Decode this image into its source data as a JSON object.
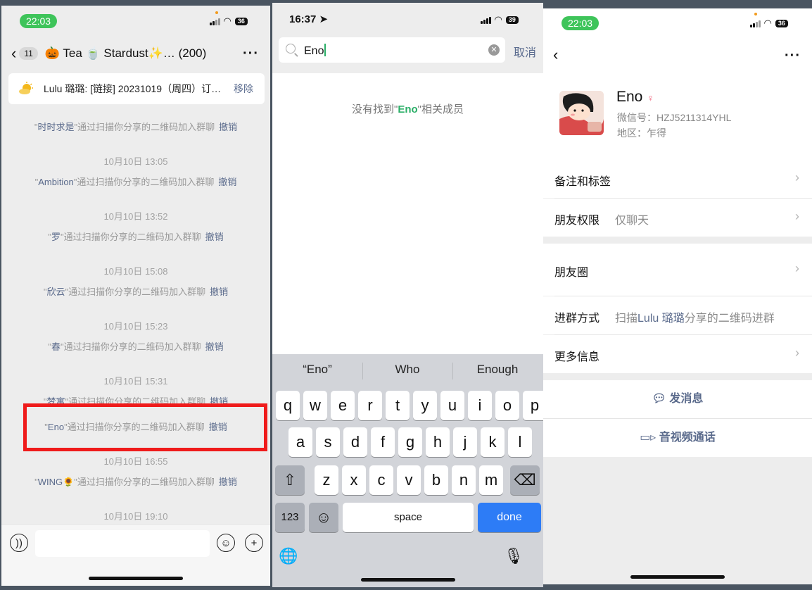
{
  "panel1": {
    "status": {
      "time": "22:03",
      "battery": "36"
    },
    "header": {
      "unread": "11",
      "title": "🎃 Tea 🍵 Stardust✨… (200)"
    },
    "pinned": {
      "text": "Lulu 璐璐: [链接] 20231019（周四）订…",
      "remove": "移除"
    },
    "messages": [
      {
        "name": "时时求是",
        "text": "\"通过扫描你分享的二维码加入群聊",
        "undo": "撤销"
      },
      {
        "time": "10月10日 13:05"
      },
      {
        "name": "Ambition",
        "text": "\"通过扫描你分享的二维码加入群聊",
        "undo": "撤销"
      },
      {
        "time": "10月10日 13:52"
      },
      {
        "name": "罗",
        "text": "\"通过扫描你分享的二维码加入群聊",
        "undo": "撤销"
      },
      {
        "time": "10月10日 15:08"
      },
      {
        "name": "欣云",
        "text": "\"通过扫描你分享的二维码加入群聊",
        "undo": "撤销"
      },
      {
        "time": "10月10日 15:23"
      },
      {
        "name": "春",
        "text": "\"通过扫描你分享的二维码加入群聊",
        "undo": "撤销"
      },
      {
        "time": "10月10日 15:31"
      },
      {
        "name": "梦寓",
        "text": "\"通过扫描你分享的二维码加入群聊",
        "undo": "撤销"
      },
      {
        "name": "Eno",
        "text": "\"通过扫描你分享的二维码加入群聊",
        "undo": "撤销"
      },
      {
        "time": "10月10日 16:55"
      },
      {
        "name": "WING🌻",
        "text": "\"通过扫描你分享的二维码加入群聊",
        "undo": "撤销"
      },
      {
        "time": "10月10日 19:10"
      }
    ],
    "icons": [
      "voice-icon",
      "emoji-icon",
      "plus-icon"
    ]
  },
  "panel2": {
    "status": {
      "time": "16:37",
      "battery": "39"
    },
    "search": {
      "query": "Eno",
      "cancel": "取消"
    },
    "empty": {
      "prefix": "没有找到\"",
      "keyword": "Eno",
      "suffix": "\"相关成员"
    },
    "suggestions": [
      "“Eno”",
      "Who",
      "Enough"
    ],
    "keyboard": {
      "row1": [
        "q",
        "w",
        "e",
        "r",
        "t",
        "y",
        "u",
        "i",
        "o",
        "p"
      ],
      "row2": [
        "a",
        "s",
        "d",
        "f",
        "g",
        "h",
        "j",
        "k",
        "l"
      ],
      "row3": [
        "z",
        "x",
        "c",
        "v",
        "b",
        "n",
        "m"
      ],
      "numbers": "123",
      "space": "space",
      "done": "done"
    }
  },
  "panel3": {
    "status": {
      "time": "22:03",
      "battery": "36"
    },
    "profile": {
      "name": "Eno",
      "wechat_id": "微信号：HZJ5211314YHL",
      "region": "地区：乍得"
    },
    "rows": {
      "remark": "备注和标签",
      "permission_label": "朋友权限",
      "permission_value": "仅聊天",
      "moments": "朋友圈",
      "join_label": "进群方式",
      "join_prefix": "扫描",
      "join_name": "Lulu 璐璐",
      "join_suffix": "分享的二维码进群",
      "more": "更多信息"
    },
    "actions": {
      "message": "发消息",
      "call": "音视频通话"
    }
  },
  "colors": {
    "accent_green": "#2aae67",
    "link_blue": "#5b6b8c",
    "highlight_red": "#ef1b1b",
    "key_blue": "#2d7cf6"
  }
}
